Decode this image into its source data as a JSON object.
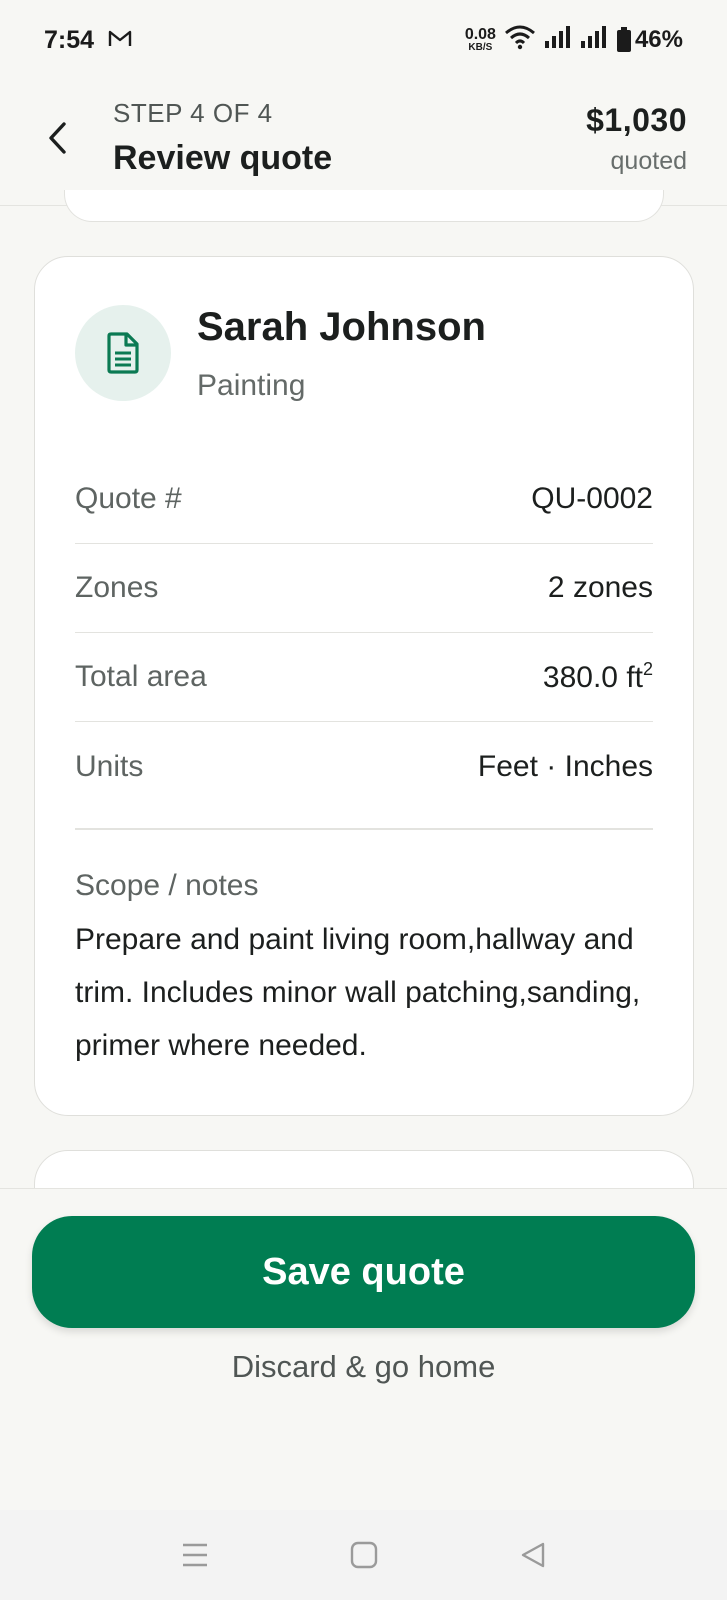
{
  "status_bar": {
    "time": "7:54",
    "mail_icon": "gmail-icon",
    "net_speed_value": "0.08",
    "net_speed_unit": "KB/S",
    "battery": "46%"
  },
  "header": {
    "step": "STEP 4 OF 4",
    "title": "Review quote",
    "total_amount": "$1,030",
    "total_label": "quoted"
  },
  "client": {
    "name": "Sarah Johnson",
    "trade": "Painting",
    "avatar_icon": "document-icon"
  },
  "details": [
    {
      "label": "Quote #",
      "value": "QU-0002"
    },
    {
      "label": "Zones",
      "value": "2 zones"
    },
    {
      "label": "Total area",
      "value": "380.0 ft",
      "value_sup": "2"
    },
    {
      "label": "Units",
      "value": "Feet · Inches"
    }
  ],
  "scope": {
    "label": "Scope / notes",
    "text": "Prepare and paint living room,hallway and trim. Includes minor wall patching,sanding, primer where needed."
  },
  "actions": {
    "save_label": "Save quote",
    "discard_label": "Discard & go home"
  },
  "colors": {
    "accent": "#007d52",
    "avatar_bg": "#e6f1ed",
    "background": "#f7f7f4"
  }
}
